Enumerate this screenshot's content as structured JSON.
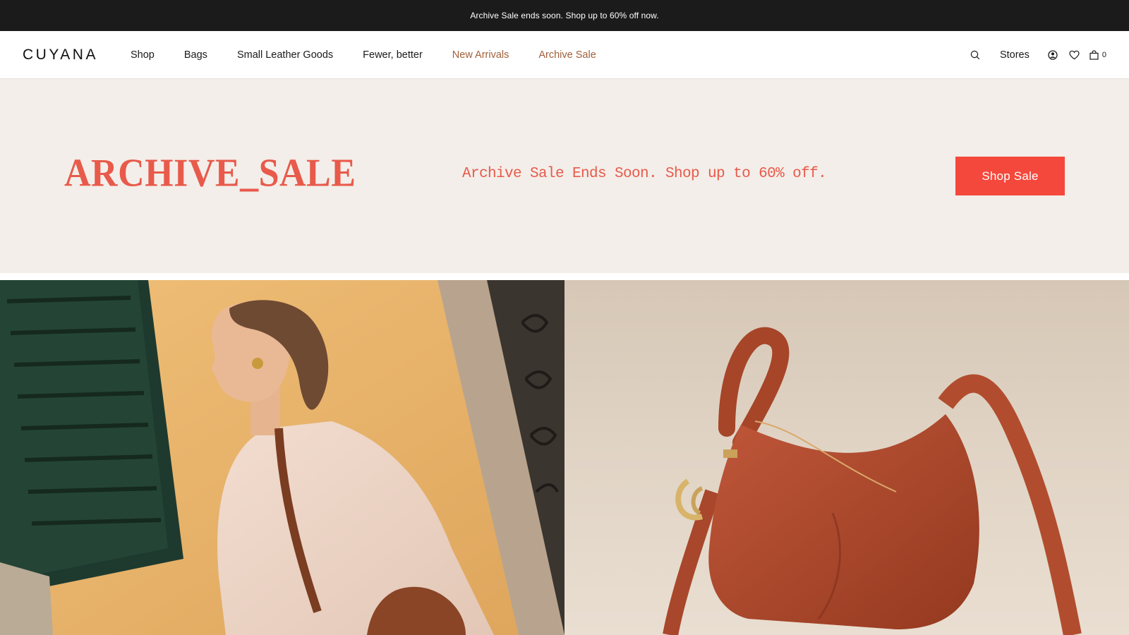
{
  "announcement": {
    "text": "Archive Sale ends soon. Shop up to 60% off now."
  },
  "header": {
    "logo": "CUYANA",
    "nav": [
      {
        "label": "Shop",
        "accent": false
      },
      {
        "label": "Bags",
        "accent": false
      },
      {
        "label": "Small Leather Goods",
        "accent": false
      },
      {
        "label": "Fewer, better",
        "accent": false
      },
      {
        "label": "New Arrivals",
        "accent": true
      },
      {
        "label": "Archive Sale",
        "accent": true
      }
    ],
    "utilities": {
      "search_icon": "search-icon",
      "stores_label": "Stores",
      "account_icon": "account-icon",
      "wishlist_icon": "heart-icon",
      "bag_icon": "shopping-bag-icon",
      "bag_count": "0"
    }
  },
  "banner": {
    "title": "ARCHIVE_SALE",
    "subtitle": "Archive Sale Ends Soon. Shop up to 60% off.",
    "button_label": "Shop Sale",
    "background": "#f3eee9",
    "accent": "#e85a4b",
    "button_color": "#f4483c"
  },
  "hero_images": [
    {
      "name": "hero-image-model-with-bag"
    },
    {
      "name": "hero-image-leather-bag"
    }
  ],
  "colors": {
    "announcement_bg": "#1b1b1b",
    "nav_accent": "#a0603a"
  }
}
